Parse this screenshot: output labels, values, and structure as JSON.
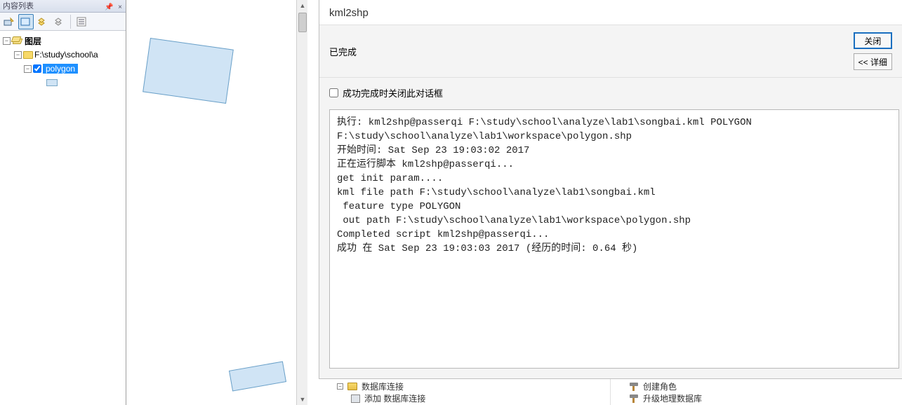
{
  "toc": {
    "panel_title": "内容列表",
    "root_label": "图层",
    "folder_label": "F:\\study\\school\\a",
    "layer_label": "polygon"
  },
  "dialog": {
    "title": "kml2shp",
    "status": "已完成",
    "close_btn": "关闭",
    "detail_btn": "<< 详细",
    "close_on_success": "成功完成时关闭此对话框",
    "log": "执行: kml2shp@passerqi F:\\study\\school\\analyze\\lab1\\songbai.kml POLYGON F:\\study\\school\\analyze\\lab1\\workspace\\polygon.shp\n开始时间: Sat Sep 23 19:03:02 2017\n正在运行脚本 kml2shp@passerqi...\nget init param....\nkml file path F:\\study\\school\\analyze\\lab1\\songbai.kml\n feature type POLYGON\n out path F:\\study\\school\\analyze\\lab1\\workspace\\polygon.shp\nCompleted script kml2shp@passerqi...\n成功 在 Sat Sep 23 19:03:03 2017 (经历的时间: 0.64 秒)"
  },
  "catalog": {
    "db_connections": "数据库连接",
    "add_db_connection": "添加 数据库连接",
    "create_role": "创建角色",
    "upgrade_geodb": "升级地理数据库"
  }
}
